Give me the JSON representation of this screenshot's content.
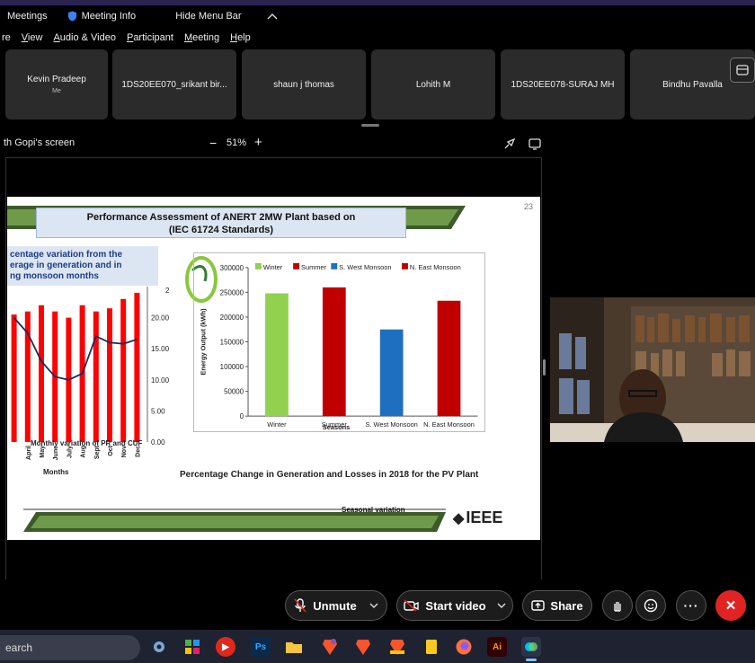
{
  "titlebar": {
    "app_menu": "Meetings",
    "meeting_info": "Meeting Info",
    "hide_menu_bar": "Hide Menu Bar"
  },
  "menubar": [
    "re",
    "View",
    "Audio & Video",
    "Participant",
    "Meeting",
    "Help"
  ],
  "participants": [
    {
      "name": "Kevin Pradeep",
      "sub": "Me"
    },
    {
      "name": "1DS20EE070_srikant bir..."
    },
    {
      "name": "shaun j thomas"
    },
    {
      "name": "Lohith M"
    },
    {
      "name": "1DS20EE078-SURAJ MH"
    },
    {
      "name": "Bindhu Pavalla"
    }
  ],
  "share": {
    "label": "th Gopi's screen",
    "zoom": "51%",
    "minus": "−",
    "plus": "+"
  },
  "slide": {
    "page_number": "23",
    "title_line1": "Performance Assessment of ANERT 2MW Plant based on",
    "title_line2": "(IEC 61724 Standards)",
    "callout_line1": "centage variation from the",
    "callout_line2": "erage  in generation and in",
    "callout_line3": "ng monsoon months",
    "left_chart_caption": "Monthly variation of PR and CUF",
    "left_chart_xlabel": "Months",
    "footer_text": "Percentage Change in Generation and Losses in 2018 for the PV Plant",
    "bottom_banner": "Seasonal variation",
    "logo": "IEEE",
    "logo_mark": "◆",
    "left_axis_ticks": [
      "20.00",
      "15.00",
      "10.00",
      "5.00",
      "0.00"
    ],
    "left_axis_top_partial": "2",
    "left_months": [
      "April",
      "May",
      "June",
      "July",
      "Aug",
      "Sept",
      "Oct",
      "Nov",
      "Dec"
    ]
  },
  "chart_data": [
    {
      "type": "bar",
      "title": "",
      "xlabel": "Seasons",
      "ylabel": "Energy Output (kWh)",
      "ylim": [
        0,
        300000
      ],
      "yticks": [
        0,
        50000,
        100000,
        150000,
        200000,
        250000,
        300000
      ],
      "categories": [
        "Winter",
        "Summer",
        "S. West Monsoon",
        "N. East Monsoon"
      ],
      "series": [
        {
          "name": "Winter",
          "color": "#92d050",
          "values": [
            248000,
            null,
            null,
            null
          ]
        },
        {
          "name": "Summer",
          "color": "#c00000",
          "values": [
            null,
            260000,
            null,
            null
          ]
        },
        {
          "name": "S. West Monsoon",
          "color": "#1f6fc0",
          "values": [
            null,
            null,
            175000,
            null
          ]
        },
        {
          "name": "N. East Monsoon",
          "color": "#c00000",
          "values": [
            null,
            null,
            null,
            233000
          ]
        }
      ],
      "legend": "top",
      "grid": false
    },
    {
      "type": "bar",
      "title": "",
      "xlabel": "Months",
      "ylim": [
        0,
        25
      ],
      "categories": [
        "",
        "April",
        "May",
        "June",
        "July",
        "Aug",
        "Sept",
        "Oct",
        "Nov",
        "Dec"
      ],
      "bars": [
        20.5,
        21,
        22,
        21,
        20,
        22,
        21,
        21.5,
        23,
        24
      ],
      "line": [
        20,
        17.5,
        13,
        10.5,
        10,
        11,
        17,
        16,
        15.8,
        16.5
      ],
      "bar_color": "#ff0000",
      "line_color": "#1f2a5a"
    }
  ],
  "controls": {
    "unmute": "Unmute",
    "start_video": "Start video",
    "share": "Share",
    "more": "···",
    "leave": "✕"
  },
  "taskbar": {
    "search": "earch",
    "apps": [
      "settings",
      "chart-app",
      "media-player",
      "Ps",
      "file-explorer",
      "brave-beta",
      "brave",
      "brave-nightly",
      "notes",
      "firefox",
      "Ai",
      "webex"
    ]
  },
  "colors": {
    "accent_red": "#e02424",
    "slide_title_bg": "#dce6f2",
    "banner_green": "#2e7d32"
  }
}
